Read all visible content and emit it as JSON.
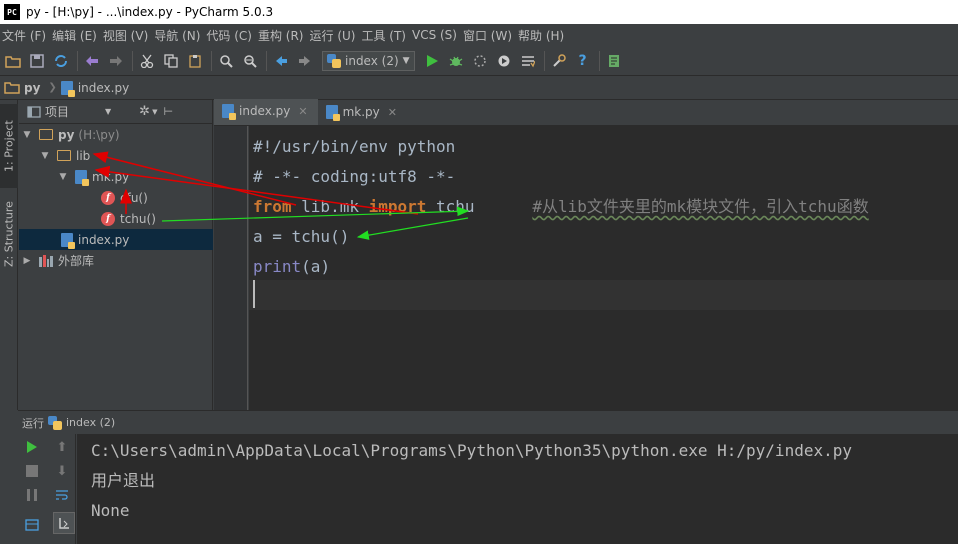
{
  "window": {
    "title": "py - [H:\\py] - ...\\index.py - PyCharm 5.0.3",
    "app_icon_text": "PC"
  },
  "menu": [
    "文件 (F)",
    "编辑 (E)",
    "视图 (V)",
    "导航 (N)",
    "代码 (C)",
    "重构 (R)",
    "运行 (U)",
    "工具 (T)",
    "VCS (S)",
    "窗口 (W)",
    "帮助 (H)"
  ],
  "toolbar": {
    "run_config": "index (2)"
  },
  "navbar": {
    "root": "py",
    "file": "index.py"
  },
  "side_tabs": {
    "project": "1: Project",
    "structure": "Z: Structure"
  },
  "project_panel": {
    "title": "项目",
    "tree": {
      "root_name": "py",
      "root_path": "(H:\\py)",
      "lib": "lib",
      "mk": "mk.py",
      "func1": "cfu()",
      "func2": "tchu()",
      "index": "index.py",
      "external": "外部库"
    }
  },
  "editor": {
    "tabs": [
      "index.py",
      "mk.py"
    ],
    "lines": {
      "l1": "#!/usr/bin/env python",
      "l2": "# -*- coding:utf8 -*-",
      "l3_kw1": "from",
      "l3_mod": " lib.mk ",
      "l3_kw2": "import",
      "l3_name": " tchu",
      "l3_comment": "#从lib文件夹里的mk模块文件，引入tchu函数",
      "l4": "a = tchu()",
      "l5_builtin": "print",
      "l5_rest": "(a)"
    }
  },
  "run_panel": {
    "label": "运行",
    "config": "index (2)",
    "output": [
      "C:\\Users\\admin\\AppData\\Local\\Programs\\Python\\Python35\\python.exe H:/py/index.py",
      "用户退出",
      "None"
    ]
  },
  "colors": {
    "background": "#2b2b2b",
    "keyword": "#cc7832",
    "comment": "#808080",
    "builtin": "#8888c6",
    "annotation_red": "#e00000",
    "annotation_green": "#22dd22"
  }
}
